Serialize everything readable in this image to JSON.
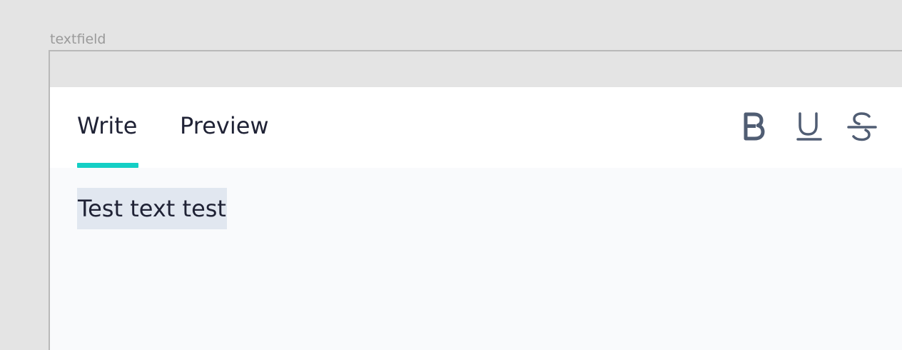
{
  "frame": {
    "label": "textfield"
  },
  "tabs": [
    {
      "label": "Write",
      "active": true
    },
    {
      "label": "Preview",
      "active": false
    }
  ],
  "format_buttons": [
    {
      "icon": "bold-icon"
    },
    {
      "icon": "underline-icon"
    },
    {
      "icon": "strikethrough-icon"
    }
  ],
  "editor": {
    "value": "Test text test",
    "selected": true
  },
  "colors": {
    "accent": "#14cfc5",
    "icon": "#505d73",
    "text": "#1f2235",
    "selection": "#e1e7f0"
  }
}
